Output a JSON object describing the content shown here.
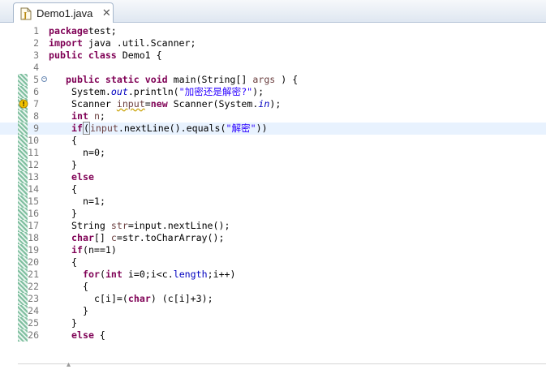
{
  "tab": {
    "title": "Demo1.java",
    "close_glyph": "✕",
    "icon": "java-file-icon"
  },
  "editor": {
    "current_line": 9,
    "lines": [
      {
        "n": "1",
        "tokens": [
          [
            "kw",
            "package"
          ],
          [
            "",
            "test;"
          ]
        ]
      },
      {
        "n": "2",
        "tokens": [
          [
            "kw",
            "import"
          ],
          [
            "",
            " java .util.Scanner;"
          ]
        ]
      },
      {
        "n": "3",
        "tokens": [
          [
            "kw",
            "public"
          ],
          [
            "",
            " "
          ],
          [
            "kw",
            "class"
          ],
          [
            "",
            " Demo1 {"
          ]
        ]
      },
      {
        "n": "4",
        "tokens": []
      },
      {
        "n": "5",
        "fold": true,
        "tokens": [
          [
            "",
            " "
          ],
          [
            "kw",
            "public"
          ],
          [
            "",
            " "
          ],
          [
            "kw",
            "static"
          ],
          [
            "",
            " "
          ],
          [
            "kw",
            "void"
          ],
          [
            "",
            " main(String[] "
          ],
          [
            "loc",
            "args"
          ],
          [
            "",
            " ) {"
          ]
        ]
      },
      {
        "n": "6",
        "tokens": [
          [
            "",
            "System."
          ],
          [
            "fld",
            "out"
          ],
          [
            "",
            ".println("
          ],
          [
            "str",
            "\"加密还是解密?\""
          ],
          [
            "",
            ");"
          ]
        ]
      },
      {
        "n": "7",
        "warn": true,
        "tokens": [
          [
            "",
            "Scanner "
          ],
          [
            "locu",
            "input"
          ],
          [
            "",
            "="
          ],
          [
            "kw",
            "new"
          ],
          [
            "",
            " Scanner(System."
          ],
          [
            "fld",
            "in"
          ],
          [
            "",
            ");"
          ]
        ]
      },
      {
        "n": "8",
        "tokens": [
          [
            "kw",
            "int"
          ],
          [
            "",
            " "
          ],
          [
            "loc",
            "n"
          ],
          [
            "",
            ";"
          ]
        ]
      },
      {
        "n": "9",
        "tokens": [
          [
            "kw",
            "if"
          ],
          [
            "cur",
            "("
          ],
          [
            "loc",
            "input"
          ],
          [
            "",
            ".nextLine().equals("
          ],
          [
            "str",
            "\"解密\""
          ],
          [
            "",
            "))"
          ]
        ]
      },
      {
        "n": "10",
        "tokens": [
          [
            "",
            "{"
          ]
        ]
      },
      {
        "n": "11",
        "tokens": [
          [
            "",
            "n=0;"
          ]
        ]
      },
      {
        "n": "12",
        "tokens": [
          [
            "",
            "}"
          ]
        ]
      },
      {
        "n": "13",
        "tokens": [
          [
            "kw",
            "else"
          ]
        ]
      },
      {
        "n": "14",
        "tokens": [
          [
            "",
            "{"
          ]
        ]
      },
      {
        "n": "15",
        "tokens": [
          [
            "",
            "n=1;"
          ]
        ]
      },
      {
        "n": "16",
        "tokens": [
          [
            "",
            "}"
          ]
        ]
      },
      {
        "n": "17",
        "tokens": [
          [
            "",
            "String "
          ],
          [
            "loc",
            "str"
          ],
          [
            "",
            "=input.nextLine();"
          ]
        ]
      },
      {
        "n": "18",
        "tokens": [
          [
            "kw",
            "char"
          ],
          [
            "",
            "[] "
          ],
          [
            "loc",
            "c"
          ],
          [
            "",
            "=str.toCharArray();"
          ]
        ]
      },
      {
        "n": "19",
        "tokens": [
          [
            "kw",
            "if"
          ],
          [
            "",
            "(n==1)"
          ]
        ]
      },
      {
        "n": "20",
        "tokens": [
          [
            "",
            "{"
          ]
        ]
      },
      {
        "n": "21",
        "tokens": [
          [
            "kw",
            "for"
          ],
          [
            "",
            "("
          ],
          [
            "kw",
            "int"
          ],
          [
            "",
            " i=0;i<c."
          ],
          [
            "fld2",
            "length"
          ],
          [
            "",
            ";i++)"
          ]
        ]
      },
      {
        "n": "22",
        "tokens": [
          [
            "",
            "{"
          ]
        ]
      },
      {
        "n": "23",
        "tokens": [
          [
            "",
            "c[i]=("
          ],
          [
            "kw",
            "char"
          ],
          [
            "",
            ") (c[i]+3);"
          ]
        ]
      },
      {
        "n": "24",
        "tokens": [
          [
            "",
            "}"
          ]
        ]
      },
      {
        "n": "25",
        "tokens": [
          [
            "",
            "}"
          ]
        ]
      },
      {
        "n": "26",
        "tokens": [
          [
            "kw",
            "else"
          ],
          [
            "",
            " {"
          ]
        ]
      }
    ]
  },
  "colors": {
    "keyword": "#7f0055",
    "string": "#2a00ff",
    "field": "#0000c0",
    "current_line_bg": "#e8f2fe"
  }
}
